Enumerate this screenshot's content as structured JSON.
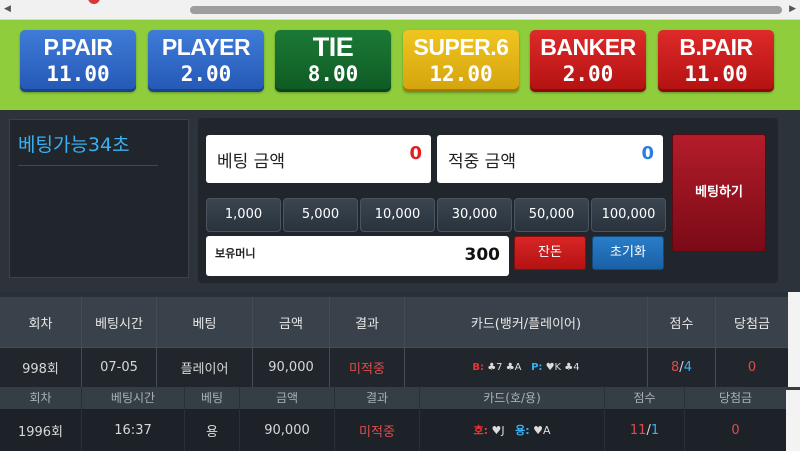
{
  "odds": [
    {
      "name": "P.PAIR",
      "value": "11.00",
      "color": "#2f6bcc"
    },
    {
      "name": "PLAYER",
      "value": "2.00",
      "color": "#2f6bcc"
    },
    {
      "name": "TIE",
      "value": "8.00",
      "color": "#17702f"
    },
    {
      "name": "SUPER.6",
      "value": "12.00",
      "color": "#e6b817"
    },
    {
      "name": "BANKER",
      "value": "2.00",
      "color": "#c71b1b"
    },
    {
      "name": "B.PAIR",
      "value": "11.00",
      "color": "#c71b1b"
    }
  ],
  "timer": {
    "label": "베팅가능34초"
  },
  "bet": {
    "bet_amount_label": "베팅 금액",
    "bet_amount": "0",
    "win_amount_label": "적중 금액",
    "win_amount": "0",
    "chips": [
      "1,000",
      "5,000",
      "10,000",
      "30,000",
      "50,000",
      "100,000"
    ],
    "money_label": "보유머니",
    "money": "300",
    "all_in_label": "잔돈",
    "reset_label": "초기화",
    "submit_label": "베팅하기"
  },
  "table1": {
    "headers": [
      "회차",
      "베팅시간",
      "베팅",
      "금액",
      "결과",
      "카드(뱅커/플레이어)",
      "점수",
      "당첨금"
    ],
    "row": {
      "round": "998회",
      "time": "07-05",
      "bet": "플레이어",
      "amount": "90,000",
      "result": "미적중",
      "banker_prefix": "B:",
      "banker_cards": "♣7 ♣A",
      "player_prefix": "P:",
      "player_cards": "♥K ♣4",
      "score_banker": "8",
      "score_sep": "/",
      "score_player": "4",
      "payout": "0"
    }
  },
  "table2": {
    "headers": [
      "회차",
      "베팅시간",
      "베팅",
      "금액",
      "결과",
      "카드(호/용)",
      "점수",
      "당첨금"
    ],
    "row": {
      "round": "1996회",
      "time": "16:37",
      "bet": "용",
      "amount": "90,000",
      "result": "미적중",
      "tiger_prefix": "호:",
      "tiger_cards": "♥J",
      "dragon_prefix": "용:",
      "dragon_cards": "♥A",
      "score_tiger": "11",
      "score_sep": "/",
      "score_dragon": "1",
      "payout": "0"
    }
  }
}
